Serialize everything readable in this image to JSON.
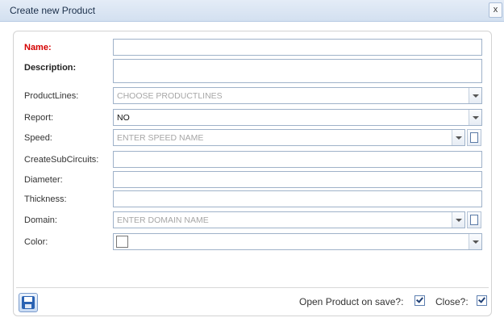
{
  "dialog": {
    "title": "Create new Product",
    "close_label": "x"
  },
  "form": {
    "name": {
      "label": "Name:",
      "value": ""
    },
    "description": {
      "label": "Description:",
      "value": ""
    },
    "productlines": {
      "label": "ProductLines:",
      "placeholder": "CHOOSE PRODUCTLINES"
    },
    "report": {
      "label": "Report:",
      "value": "NO"
    },
    "speed": {
      "label": "Speed:",
      "placeholder": "ENTER SPEED NAME"
    },
    "createsubcircuits": {
      "label": "CreateSubCircuits:",
      "value": ""
    },
    "diameter": {
      "label": "Diameter:",
      "value": ""
    },
    "thickness": {
      "label": "Thickness:",
      "value": ""
    },
    "domain": {
      "label": "Domain:",
      "placeholder": "ENTER DOMAIN NAME"
    },
    "color": {
      "label": "Color:",
      "value": "#ffffff"
    }
  },
  "footer": {
    "open_on_save_label": "Open Product on save?:",
    "open_on_save_checked": true,
    "close_label": "Close?:",
    "close_checked": true
  },
  "colors": {
    "required_label": "#d40000",
    "titlebar": "#d3e0f0",
    "field_border": "#9fb2c9",
    "save_icon": "#2a62b3"
  }
}
